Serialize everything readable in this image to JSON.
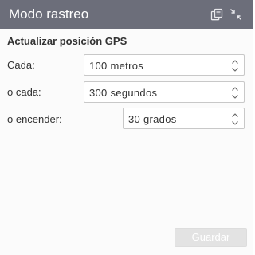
{
  "header": {
    "title": "Modo rastreo",
    "bg_color": "#6c6e7a",
    "icons": [
      "copy-icon",
      "collapse-icon"
    ]
  },
  "section": {
    "title": "Actualizar posición GPS"
  },
  "rows": [
    {
      "label": "Cada:",
      "value": "100 metros"
    },
    {
      "label": "o cada:",
      "value": "300 segundos"
    },
    {
      "label": "o encender:",
      "value": "30 grados"
    }
  ],
  "footer": {
    "save_label": "Guardar",
    "save_disabled": true
  }
}
